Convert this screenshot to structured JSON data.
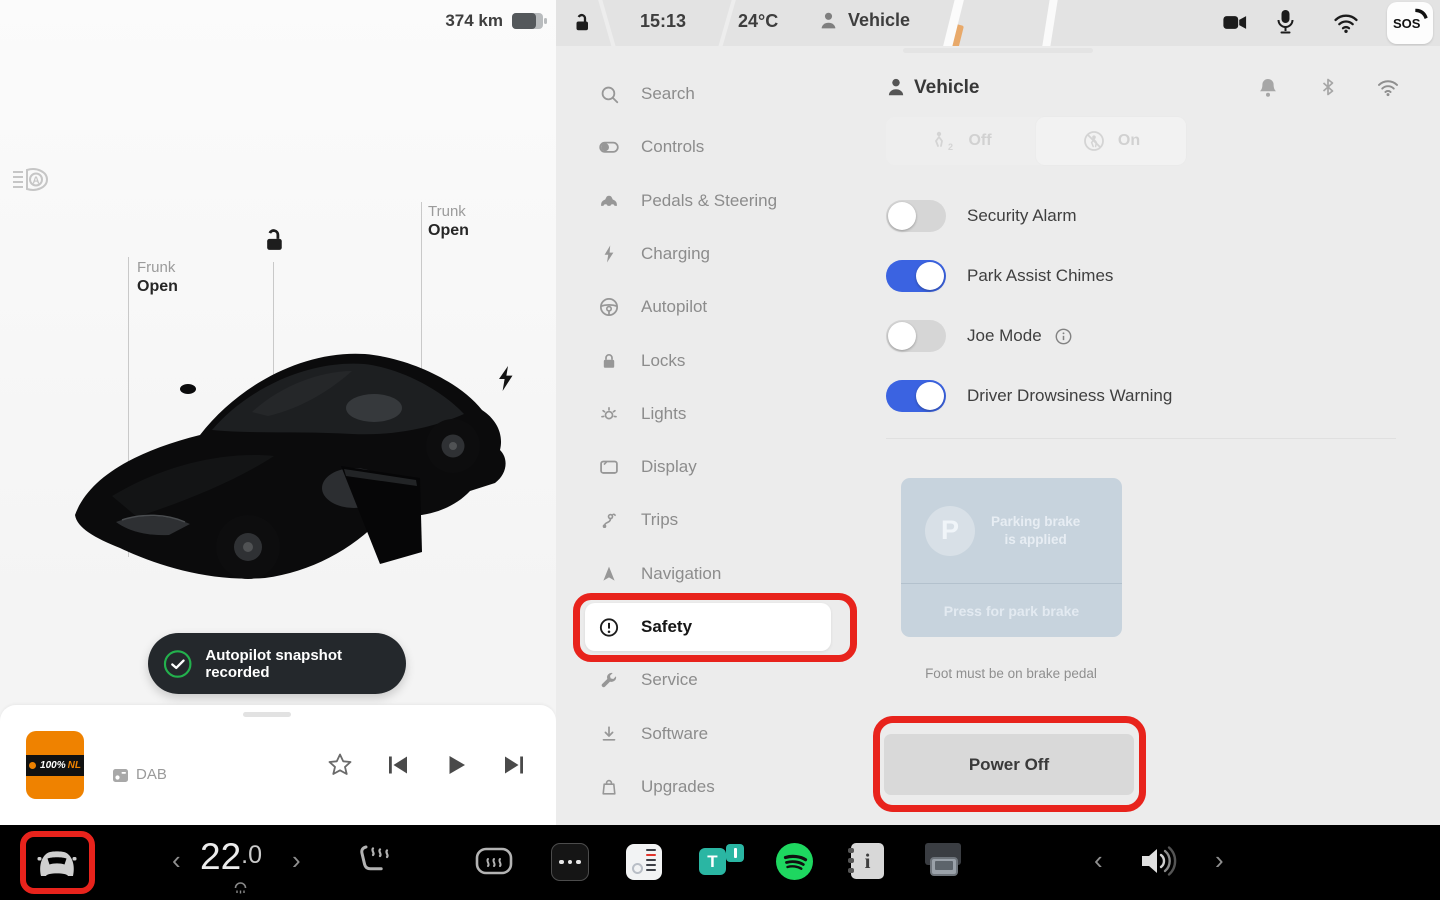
{
  "colors": {
    "accent-blue": "#3b63e1",
    "annotation-red": "#e8231c",
    "toast-green": "#23b14d",
    "spotify-green": "#1ed760",
    "tunein-teal": "#2ab6a3",
    "album-orange": "#ef8200",
    "park-card-blue": "#c7d3dd"
  },
  "left_panel": {
    "range": "374 km",
    "frunk": {
      "label": "Frunk",
      "status": "Open"
    },
    "trunk": {
      "label": "Trunk",
      "status": "Open"
    },
    "toast": "Autopilot snapshot recorded",
    "media": {
      "station_left": "100%",
      "station_right": "NL",
      "source": "DAB"
    }
  },
  "status_bar": {
    "time": "15:13",
    "temperature": "24°C",
    "profile": "Vehicle",
    "sos": "SOS"
  },
  "settings": {
    "menu": [
      {
        "label": "Search"
      },
      {
        "label": "Controls"
      },
      {
        "label": "Pedals & Steering"
      },
      {
        "label": "Charging"
      },
      {
        "label": "Autopilot"
      },
      {
        "label": "Locks"
      },
      {
        "label": "Lights"
      },
      {
        "label": "Display"
      },
      {
        "label": "Trips"
      },
      {
        "label": "Navigation"
      },
      {
        "label": "Safety"
      },
      {
        "label": "Service"
      },
      {
        "label": "Software"
      },
      {
        "label": "Upgrades"
      }
    ],
    "selected_item": "Safety",
    "content": {
      "title": "Vehicle",
      "segmented": {
        "off": "Off",
        "on": "On"
      },
      "toggles": [
        {
          "label": "Security Alarm",
          "on": false
        },
        {
          "label": "Park Assist Chimes",
          "on": true
        },
        {
          "label": "Joe Mode",
          "on": false,
          "info": true
        },
        {
          "label": "Driver Drowsiness Warning",
          "on": true
        }
      ],
      "park_brake": {
        "p_letter": "P",
        "line1": "Parking brake",
        "line2": "is applied",
        "press": "Press for park brake"
      },
      "footnote": "Foot must be on brake pedal",
      "power_off": "Power Off"
    }
  },
  "bottom_bar": {
    "temp_int": "22",
    "temp_frac": ".0",
    "tunein_letter": "T",
    "manual_letter": "i"
  }
}
